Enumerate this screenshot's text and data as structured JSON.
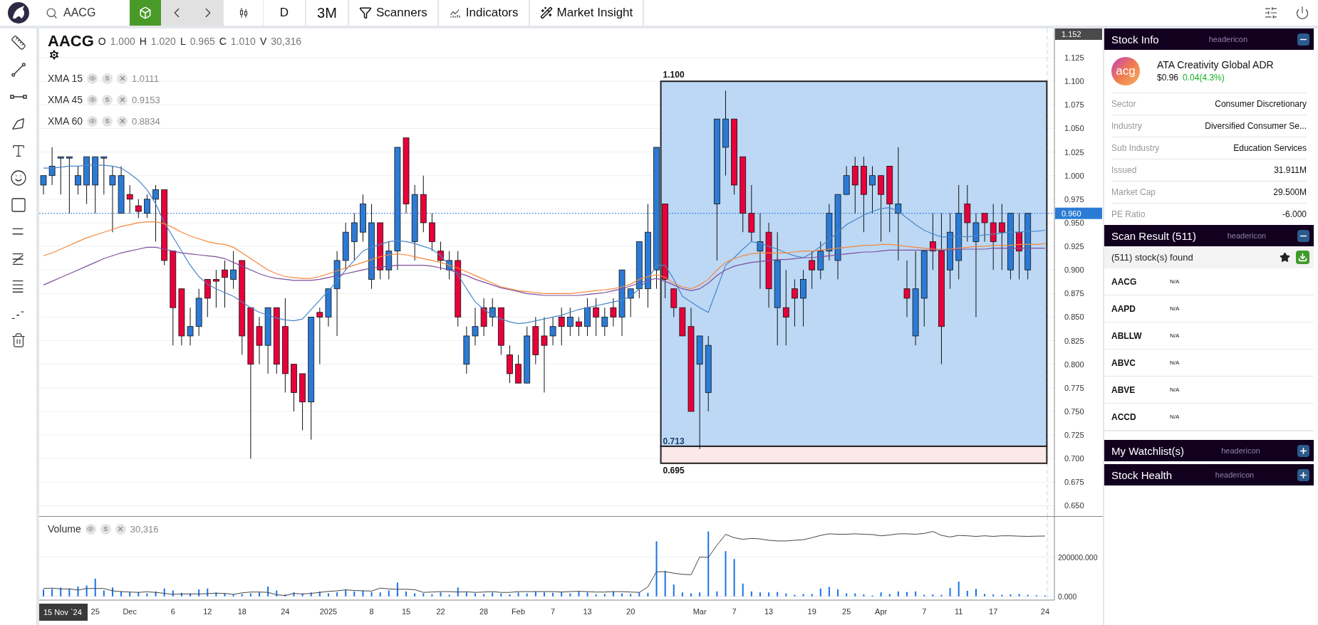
{
  "toolbar": {
    "search_value": "AACG",
    "interval": "D",
    "range": "3M",
    "menus": [
      "Scanners",
      "Indicators",
      "Market Insight"
    ]
  },
  "chart": {
    "symbol": "AACG",
    "ohlcv": [
      {
        "label": "O",
        "value": "1.000"
      },
      {
        "label": "H",
        "value": "1.020"
      },
      {
        "label": "L",
        "value": "0.965"
      },
      {
        "label": "C",
        "value": "1.010"
      },
      {
        "label": "V",
        "value": "30,316"
      }
    ],
    "indicators": [
      {
        "value": "1.0111",
        "icons": [
          "S"
        ]
      },
      {
        "value": "0.9153",
        "icons": [
          "S"
        ]
      },
      {
        "value": "0.8834",
        "icons": [
          "S"
        ]
      }
    ],
    "top_axis_label": "1.152",
    "chart_data": {
      "type": "candlestick",
      "grid": true,
      "ylim": [
        0.639,
        1.156
      ],
      "yticks": [
        {
          "value": 0.65,
          "label": "0.650"
        },
        {
          "value": 0.675,
          "label": "0.675"
        },
        {
          "value": 0.7,
          "label": "0.700"
        },
        {
          "value": 0.725,
          "label": "0.725"
        },
        {
          "value": 0.75,
          "label": "0.750"
        },
        {
          "value": 0.775,
          "label": "0.775"
        },
        {
          "value": 0.8,
          "label": "0.800"
        },
        {
          "value": 0.825,
          "label": "0.825"
        },
        {
          "value": 0.85,
          "label": "0.850"
        },
        {
          "value": 0.875,
          "label": "0.875"
        },
        {
          "value": 0.9,
          "label": "0.900"
        },
        {
          "value": 0.925,
          "label": "0.925"
        },
        {
          "value": 0.95,
          "label": "0.950"
        },
        {
          "value": 0.975,
          "label": "0.975"
        },
        {
          "value": 1.0,
          "label": "1.000"
        },
        {
          "value": 1.025,
          "label": "1.025"
        },
        {
          "value": 1.05,
          "label": "1.050"
        },
        {
          "value": 1.075,
          "label": "1.075"
        },
        {
          "value": 1.1,
          "label": "1.100"
        },
        {
          "value": 1.125,
          "label": "1.125"
        }
      ],
      "ohlc": [
        [
          0.99,
          1.0,
          0.98,
          1.0
        ],
        [
          1.0,
          1.03,
          0.99,
          1.01
        ],
        [
          1.02,
          1.02,
          0.98,
          1.02
        ],
        [
          1.02,
          1.02,
          0.96,
          1.02
        ],
        [
          0.99,
          1.01,
          0.98,
          1.0
        ],
        [
          0.99,
          1.02,
          0.97,
          1.02
        ],
        [
          0.99,
          1.02,
          0.96,
          1.02
        ],
        [
          1.02,
          1.02,
          0.98,
          1.02
        ],
        [
          0.99,
          1.01,
          0.94,
          1.0
        ],
        [
          0.96,
          1.01,
          0.96,
          1.0
        ],
        [
          0.98,
          0.99,
          0.96,
          0.975
        ],
        [
          0.968,
          0.975,
          0.955,
          0.962
        ],
        [
          0.96,
          0.98,
          0.955,
          0.975
        ],
        [
          0.975,
          0.99,
          0.93,
          0.985
        ],
        [
          0.985,
          0.985,
          0.905,
          0.91
        ],
        [
          0.92,
          0.92,
          0.82,
          0.86
        ],
        [
          0.88,
          0.88,
          0.82,
          0.83
        ],
        [
          0.83,
          0.86,
          0.82,
          0.84
        ],
        [
          0.84,
          0.88,
          0.83,
          0.87
        ],
        [
          0.89,
          0.89,
          0.85,
          0.87
        ],
        [
          0.89,
          0.9,
          0.86,
          0.888
        ],
        [
          0.9,
          0.91,
          0.86,
          0.892
        ],
        [
          0.89,
          0.92,
          0.88,
          0.9
        ],
        [
          0.91,
          0.91,
          0.81,
          0.83
        ],
        [
          0.86,
          0.86,
          0.7,
          0.8
        ],
        [
          0.84,
          0.85,
          0.8,
          0.82
        ],
        [
          0.82,
          0.86,
          0.79,
          0.86
        ],
        [
          0.86,
          0.86,
          0.79,
          0.8
        ],
        [
          0.84,
          0.87,
          0.77,
          0.79
        ],
        [
          0.8,
          0.8,
          0.75,
          0.77
        ],
        [
          0.79,
          0.79,
          0.73,
          0.76
        ],
        [
          0.76,
          0.85,
          0.72,
          0.85
        ],
        [
          0.855,
          0.86,
          0.8,
          0.85
        ],
        [
          0.85,
          0.88,
          0.84,
          0.88
        ],
        [
          0.88,
          0.92,
          0.83,
          0.91
        ],
        [
          0.91,
          0.95,
          0.9,
          0.94
        ],
        [
          0.93,
          0.96,
          0.91,
          0.95
        ],
        [
          0.94,
          0.98,
          0.93,
          0.97
        ],
        [
          0.89,
          0.97,
          0.88,
          0.95
        ],
        [
          0.95,
          0.95,
          0.89,
          0.9
        ],
        [
          0.9,
          0.93,
          0.89,
          0.92
        ],
        [
          0.92,
          1.03,
          0.9,
          1.03
        ],
        [
          1.04,
          1.04,
          0.96,
          0.97
        ],
        [
          0.93,
          0.99,
          0.91,
          0.98
        ],
        [
          0.98,
          1.0,
          0.94,
          0.95
        ],
        [
          0.95,
          0.96,
          0.92,
          0.93
        ],
        [
          0.92,
          0.93,
          0.9,
          0.91
        ],
        [
          0.9,
          0.92,
          0.89,
          0.91
        ],
        [
          0.91,
          0.92,
          0.84,
          0.85
        ],
        [
          0.8,
          0.84,
          0.79,
          0.83
        ],
        [
          0.83,
          0.86,
          0.82,
          0.84
        ],
        [
          0.86,
          0.87,
          0.83,
          0.84
        ],
        [
          0.85,
          0.87,
          0.84,
          0.86
        ],
        [
          0.86,
          0.86,
          0.81,
          0.82
        ],
        [
          0.81,
          0.82,
          0.78,
          0.79
        ],
        [
          0.8,
          0.81,
          0.78,
          0.78
        ],
        [
          0.78,
          0.84,
          0.78,
          0.83
        ],
        [
          0.84,
          0.85,
          0.8,
          0.81
        ],
        [
          0.83,
          0.85,
          0.77,
          0.82
        ],
        [
          0.83,
          0.85,
          0.82,
          0.84
        ],
        [
          0.85,
          0.86,
          0.82,
          0.84
        ],
        [
          0.84,
          0.86,
          0.83,
          0.85
        ],
        [
          0.845,
          0.85,
          0.83,
          0.84
        ],
        [
          0.84,
          0.87,
          0.83,
          0.86
        ],
        [
          0.86,
          0.87,
          0.83,
          0.85
        ],
        [
          0.84,
          0.86,
          0.83,
          0.85
        ],
        [
          0.86,
          0.87,
          0.84,
          0.85
        ],
        [
          0.85,
          0.9,
          0.83,
          0.9
        ],
        [
          0.87,
          0.88,
          0.85,
          0.88
        ],
        [
          0.88,
          0.93,
          0.87,
          0.93
        ],
        [
          0.88,
          0.97,
          0.86,
          0.94
        ],
        [
          0.9,
          1.03,
          0.88,
          1.03
        ],
        [
          0.97,
          0.97,
          0.87,
          0.89
        ],
        [
          0.88,
          0.88,
          0.85,
          0.86
        ],
        [
          0.86,
          0.86,
          0.83,
          0.83
        ],
        [
          0.84,
          0.86,
          0.75,
          0.75
        ],
        [
          0.8,
          0.83,
          0.71,
          0.83
        ],
        [
          0.77,
          0.83,
          0.75,
          0.82
        ],
        [
          0.97,
          1.06,
          0.91,
          1.06
        ],
        [
          1.03,
          1.09,
          1.0,
          1.06
        ],
        [
          1.06,
          1.06,
          0.98,
          0.99
        ],
        [
          1.02,
          1.02,
          0.94,
          0.96
        ],
        [
          0.96,
          0.99,
          0.93,
          0.94
        ],
        [
          0.92,
          0.96,
          0.88,
          0.93
        ],
        [
          0.94,
          0.95,
          0.86,
          0.88
        ],
        [
          0.86,
          0.94,
          0.82,
          0.91
        ],
        [
          0.86,
          0.9,
          0.82,
          0.85
        ],
        [
          0.88,
          0.89,
          0.84,
          0.87
        ],
        [
          0.87,
          0.9,
          0.84,
          0.89
        ],
        [
          0.91,
          0.92,
          0.88,
          0.9
        ],
        [
          0.9,
          0.93,
          0.89,
          0.92
        ],
        [
          0.92,
          0.97,
          0.91,
          0.96
        ],
        [
          0.91,
          0.98,
          0.89,
          0.98
        ],
        [
          0.98,
          1.01,
          0.98,
          1.0
        ],
        [
          1.01,
          1.02,
          0.96,
          0.99
        ],
        [
          1.01,
          1.02,
          0.94,
          0.98
        ],
        [
          0.99,
          1.01,
          0.96,
          1.0
        ],
        [
          1.0,
          1.0,
          0.93,
          0.98
        ],
        [
          1.01,
          1.01,
          0.94,
          0.97
        ],
        [
          0.96,
          1.03,
          0.91,
          0.97
        ],
        [
          0.88,
          0.91,
          0.85,
          0.87
        ],
        [
          0.83,
          0.92,
          0.82,
          0.88
        ],
        [
          0.87,
          0.92,
          0.84,
          0.92
        ],
        [
          0.93,
          0.96,
          0.9,
          0.92
        ],
        [
          0.92,
          0.96,
          0.8,
          0.84
        ],
        [
          0.9,
          0.96,
          0.88,
          0.94
        ],
        [
          0.91,
          0.99,
          0.89,
          0.96
        ],
        [
          0.97,
          0.99,
          0.93,
          0.95
        ],
        [
          0.93,
          0.96,
          0.85,
          0.95
        ],
        [
          0.96,
          0.96,
          0.93,
          0.95
        ],
        [
          0.95,
          0.97,
          0.9,
          0.93
        ],
        [
          0.95,
          0.97,
          0.9,
          0.94
        ],
        [
          0.9,
          0.96,
          0.89,
          0.96
        ],
        [
          0.94,
          0.96,
          0.89,
          0.92
        ],
        [
          0.9,
          0.96,
          0.89,
          0.96
        ]
      ],
      "series": [
        {
          "name": "XMA 15",
          "type": "line",
          "color": "#4a86c8",
          "values": [
            1.008,
            1.008,
            1.009,
            1.01,
            1.01,
            1.011,
            1.011,
            1.011,
            1.01,
            1.008,
            1.002,
            0.995,
            0.985,
            0.97,
            0.95,
            0.935,
            0.92,
            0.905,
            0.893,
            0.885,
            0.88,
            0.876,
            0.872,
            0.866,
            0.86,
            0.855,
            0.852,
            0.849,
            0.847,
            0.846,
            0.848,
            0.858,
            0.868,
            0.878,
            0.888,
            0.9,
            0.91,
            0.92,
            0.924,
            0.927,
            0.93,
            0.931,
            0.93,
            0.928,
            0.925,
            0.922,
            0.915,
            0.905,
            0.895,
            0.88,
            0.866,
            0.858,
            0.852,
            0.848,
            0.845,
            0.843,
            0.844,
            0.846,
            0.848,
            0.85,
            0.852,
            0.855,
            0.858,
            0.86,
            0.862,
            0.864,
            0.866,
            0.868,
            0.872,
            0.88,
            0.89,
            0.905,
            0.905,
            0.89,
            0.872,
            0.866,
            0.86,
            0.855,
            0.88,
            0.905,
            0.913,
            0.922,
            0.93,
            0.928,
            0.925,
            0.922,
            0.918,
            0.915,
            0.913,
            0.918,
            0.925,
            0.932,
            0.94,
            0.948,
            0.953,
            0.958,
            0.962,
            0.965,
            0.966,
            0.962,
            0.955,
            0.948,
            0.942,
            0.938,
            0.935,
            0.935,
            0.936,
            0.935,
            0.936,
            0.937,
            0.938,
            0.939,
            0.94,
            0.94,
            0.941,
            0.941,
            0.942
          ]
        },
        {
          "name": "XMA 45",
          "type": "line",
          "color": "#f5873a",
          "values": [
            0.915,
            0.918,
            0.922,
            0.926,
            0.93,
            0.934,
            0.937,
            0.94,
            0.943,
            0.946,
            0.948,
            0.95,
            0.951,
            0.951,
            0.949,
            0.945,
            0.94,
            0.936,
            0.933,
            0.93,
            0.928,
            0.927,
            0.924,
            0.918,
            0.912,
            0.906,
            0.9,
            0.896,
            0.893,
            0.892,
            0.891,
            0.891,
            0.893,
            0.896,
            0.899,
            0.902,
            0.905,
            0.908,
            0.911,
            0.914,
            0.916,
            0.917,
            0.916,
            0.914,
            0.912,
            0.91,
            0.908,
            0.905,
            0.902,
            0.898,
            0.894,
            0.89,
            0.886,
            0.882,
            0.88,
            0.878,
            0.877,
            0.876,
            0.875,
            0.875,
            0.875,
            0.875,
            0.876,
            0.877,
            0.878,
            0.879,
            0.88,
            0.882,
            0.885,
            0.89,
            0.893,
            0.895,
            0.892,
            0.886,
            0.882,
            0.88,
            0.884,
            0.89,
            0.9,
            0.908,
            0.912,
            0.915,
            0.917,
            0.918,
            0.918,
            0.918,
            0.918,
            0.919,
            0.92,
            0.92,
            0.921,
            0.922,
            0.923,
            0.924,
            0.925,
            0.926,
            0.926,
            0.927,
            0.927,
            0.926,
            0.925,
            0.924,
            0.923,
            0.922,
            0.922,
            0.922,
            0.923,
            0.924,
            0.925,
            0.925,
            0.926,
            0.926,
            0.926,
            0.927,
            0.927,
            0.927,
            0.928
          ]
        },
        {
          "name": "XMA 60",
          "type": "line",
          "color": "#7d4f9e",
          "values": [
            0.884,
            0.888,
            0.892,
            0.896,
            0.9,
            0.904,
            0.908,
            0.912,
            0.915,
            0.918,
            0.92,
            0.922,
            0.924,
            0.924,
            0.922,
            0.92,
            0.918,
            0.917,
            0.916,
            0.915,
            0.914,
            0.912,
            0.908,
            0.904,
            0.9,
            0.896,
            0.893,
            0.891,
            0.89,
            0.889,
            0.889,
            0.889,
            0.89,
            0.892,
            0.894,
            0.896,
            0.898,
            0.9,
            0.902,
            0.903,
            0.904,
            0.905,
            0.905,
            0.905,
            0.905,
            0.904,
            0.902,
            0.9,
            0.897,
            0.894,
            0.89,
            0.887,
            0.884,
            0.881,
            0.879,
            0.877,
            0.875,
            0.874,
            0.873,
            0.873,
            0.873,
            0.873,
            0.873,
            0.874,
            0.875,
            0.876,
            0.878,
            0.88,
            0.883,
            0.886,
            0.889,
            0.891,
            0.888,
            0.884,
            0.88,
            0.878,
            0.88,
            0.886,
            0.894,
            0.9,
            0.904,
            0.906,
            0.908,
            0.909,
            0.91,
            0.911,
            0.911,
            0.912,
            0.913,
            0.913,
            0.914,
            0.915,
            0.916,
            0.917,
            0.918,
            0.919,
            0.919,
            0.92,
            0.921,
            0.921,
            0.921,
            0.921,
            0.921,
            0.921,
            0.921,
            0.921,
            0.922,
            0.922,
            0.922,
            0.922,
            0.923,
            0.923,
            0.923,
            0.923,
            0.923,
            0.923,
            0.923
          ]
        }
      ],
      "bands": [
        {
          "axis": "y",
          "from": 0.713,
          "to": 1.1,
          "color": "#bcd8f5"
        },
        {
          "axis": "y",
          "from": 0.695,
          "to": 0.713,
          "color": "#fbe8e8"
        }
      ],
      "ref_lines": [
        {
          "axis": "y",
          "value": 0.96,
          "label": "0.960",
          "color": "#2b7bd6"
        }
      ],
      "annotations": [
        {
          "text": "1.100"
        },
        {
          "text": "0.713"
        },
        {
          "text": "0.695"
        }
      ]
    }
  },
  "volume": {
    "value": "30,316",
    "icons": [
      "S"
    ],
    "chart_data": {
      "type": "bar",
      "grid": true,
      "ylim": [
        -19000,
        408200
      ],
      "yticks": [
        {
          "value": 0,
          "label": "0.000"
        },
        {
          "value": 200000,
          "label": "200000.000"
        }
      ],
      "categories": [
        null,
        null,
        null,
        null,
        null,
        null,
        "25",
        null,
        null,
        null,
        "Dec",
        null,
        null,
        null,
        null,
        "6",
        null,
        null,
        null,
        "12",
        null,
        null,
        null,
        "18",
        null,
        null,
        null,
        null,
        "24",
        null,
        null,
        null,
        null,
        "2025",
        null,
        null,
        null,
        null,
        "8",
        null,
        null,
        null,
        "15",
        null,
        null,
        null,
        "22",
        null,
        null,
        null,
        null,
        "28",
        null,
        null,
        null,
        "Feb",
        null,
        null,
        null,
        "7",
        null,
        null,
        null,
        "13",
        null,
        null,
        null,
        null,
        "20",
        null,
        null,
        null,
        null,
        null,
        null,
        null,
        "Mar",
        null,
        null,
        null,
        "7",
        null,
        null,
        null,
        "13",
        null,
        null,
        null,
        null,
        "19",
        null,
        null,
        null,
        "25",
        null,
        null,
        null,
        "Apr",
        null,
        null,
        null,
        null,
        "7",
        null,
        null,
        null,
        "11",
        null,
        null,
        null,
        "17",
        null,
        null,
        null,
        null,
        null,
        "24"
      ],
      "series": [
        {
          "name": "Volume",
          "color": "#1a73e8",
          "values": [
            35000,
            38000,
            45000,
            40000,
            50000,
            55000,
            90000,
            30000,
            45000,
            25000,
            20000,
            22000,
            15000,
            25000,
            40000,
            30000,
            18000,
            15000,
            35000,
            40000,
            20000,
            15000,
            10000,
            12000,
            15000,
            20000,
            50000,
            30000,
            10000,
            20000,
            15000,
            20000,
            25000,
            15000,
            20000,
            35000,
            25000,
            30000,
            22000,
            20000,
            30000,
            70000,
            25000,
            15000,
            15000,
            10000,
            20000,
            8000,
            45000,
            20000,
            15000,
            12000,
            20000,
            15000,
            10000,
            20000,
            15000,
            25000,
            20000,
            18000,
            22000,
            15000,
            25000,
            20000,
            10000,
            12000,
            25000,
            15000,
            12000,
            20000,
            18000,
            280000,
            130000,
            60000,
            20000,
            15000,
            20000,
            330000,
            25000,
            230000,
            190000,
            65000,
            25000,
            20000,
            20000,
            22000,
            15000,
            8000,
            12000,
            12000,
            40000,
            48000,
            35000,
            15000,
            15000,
            10000,
            5000,
            20000,
            12000,
            25000,
            22000,
            25000,
            8000,
            10000,
            8000,
            42000,
            75000,
            28000,
            38000,
            12000,
            10000,
            8000,
            10000,
            12000,
            8000,
            6000,
            5000
          ]
        },
        {
          "type": "line",
          "color": "#444444",
          "values": [
            40000,
            42000,
            38000,
            38000,
            32000,
            40000,
            40000,
            40000,
            28000,
            24000,
            22000,
            20000,
            23000,
            20000,
            15000,
            10000,
            12000,
            12000,
            12000,
            14000,
            16000,
            15000,
            10000,
            18000,
            22000,
            22000,
            20000,
            8000,
            4000,
            15000,
            12000,
            15000,
            20000,
            25000,
            28000,
            33000,
            30000,
            28000,
            27000,
            42000,
            38000,
            36000,
            36000,
            34000,
            20000,
            22000,
            24000,
            24000,
            22000,
            23000,
            20000,
            22000,
            24000,
            20000,
            20000,
            24000,
            24000,
            24000,
            24000,
            24000,
            22000,
            24000,
            26000,
            24000,
            22000,
            22000,
            24000,
            24000,
            22000,
            20000,
            48000,
            125000,
            125000,
            118000,
            112000,
            110000,
            200000,
            198000,
            260000,
            315000,
            298000,
            290000,
            295000,
            292000,
            285000,
            282000,
            282000,
            285000,
            288000,
            298000,
            310000,
            318000,
            316000,
            316000,
            318000,
            316000,
            314000,
            308000,
            312000,
            318000,
            318000,
            316000,
            320000,
            330000,
            310000,
            302000,
            310000,
            308000,
            305000,
            308000,
            305000,
            308000,
            308000,
            306000,
            305000,
            306000,
            307000
          ]
        }
      ]
    }
  },
  "cursor_date": "15 Nov `24",
  "stock_info": {
    "title": "Stock Info",
    "header_icon": "headericon",
    "expanded": true,
    "logo_text": "acg",
    "name": "ATA Creativity Global ADR",
    "price": "$0.96",
    "change": "0.04(4.3%)",
    "rows": [
      {
        "label": "Sector",
        "value": "Consumer Discretionary"
      },
      {
        "label": "Industry",
        "value": "Diversified Consumer Se..."
      },
      {
        "label": "Sub Industry",
        "value": "Education Services"
      },
      {
        "label": "Issued",
        "value": "31.911M"
      },
      {
        "label": "Market Cap",
        "value": "29.500M"
      },
      {
        "label": "PE Ratio",
        "value": "-6.000"
      }
    ]
  },
  "scan_result": {
    "title": "Scan Result (511)",
    "header_icon": "headericon",
    "expanded": true,
    "found": "(511) stock(s) found",
    "rows": [
      {
        "symbol": "AACG",
        "value": "N/A"
      },
      {
        "symbol": "AAPD",
        "value": "N/A"
      },
      {
        "symbol": "ABLLW",
        "value": "N/A"
      },
      {
        "symbol": "ABVC",
        "value": "N/A"
      },
      {
        "symbol": "ABVE",
        "value": "N/A"
      },
      {
        "symbol": "ACCD",
        "value": "N/A"
      }
    ]
  },
  "collapsed_panels": [
    {
      "title": "My Watchlist(s)",
      "header_icon": "headericon",
      "expanded": false
    },
    {
      "title": "Stock Health",
      "header_icon": "headericon",
      "expanded": false
    }
  ]
}
